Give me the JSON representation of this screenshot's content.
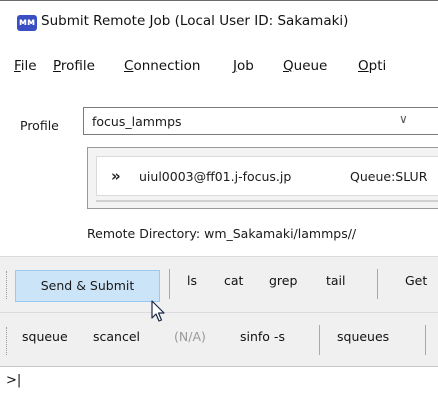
{
  "window": {
    "title": "Submit Remote Job  (Local User ID: Sakamaki)",
    "app_icon_text": "ᴍᴍ"
  },
  "menu": {
    "items": [
      {
        "prefix": "",
        "mnemonic": "F",
        "rest": "ile"
      },
      {
        "prefix": "",
        "mnemonic": "P",
        "rest": "rofile"
      },
      {
        "prefix": "",
        "mnemonic": "C",
        "rest": "onnection"
      },
      {
        "prefix": "",
        "mnemonic": "J",
        "rest": "ob"
      },
      {
        "prefix": "",
        "mnemonic": "Q",
        "rest": "ueue"
      },
      {
        "prefix": "",
        "mnemonic": "O",
        "rest": "pti"
      }
    ]
  },
  "profile": {
    "label": "Profile",
    "value": "focus_lammps",
    "chevron": "∨"
  },
  "connection": {
    "chevron": "»",
    "host": "uiul0003@ff01.j-focus.jp",
    "queue": "Queue:SLUR"
  },
  "remote_dir": "Remote Directory: wm_Sakamaki/lammps//",
  "toolbar1": {
    "send_submit": "Send & Submit",
    "ls": "ls",
    "cat": "cat",
    "grep": "grep",
    "tail": "tail",
    "get": "Get"
  },
  "toolbar2": {
    "squeue": "squeue",
    "scancel": "scancel",
    "na": "(N/A)",
    "sinfo": "sinfo -s",
    "squeues": "squeues"
  },
  "console": {
    "prompt": ">|"
  },
  "colors": {
    "highlight": "#cce4f7",
    "highlight_border": "#99c9ef",
    "toolbar_bg": "#f0f0f0",
    "disabled_text": "#9a9a9a",
    "icon": "#3a4fc2"
  }
}
